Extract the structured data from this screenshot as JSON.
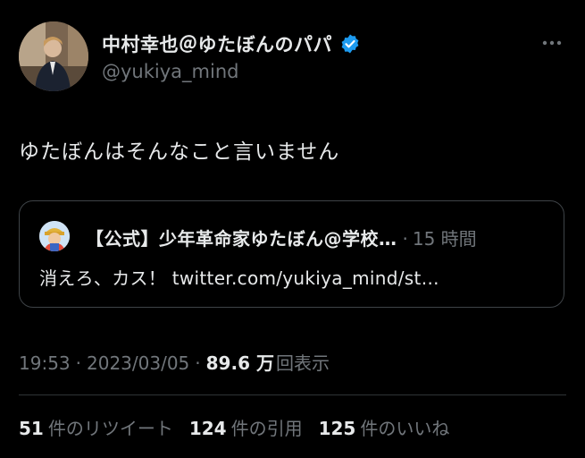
{
  "author": {
    "display_name": "中村幸也＠ゆたぼんのパパ",
    "handle": "@yukiya_mind",
    "verified": true,
    "avatar_icon": "profile-photo",
    "verified_color": "#1d9bf0"
  },
  "tweet": {
    "text": "ゆたぼんはそんなこと言いません"
  },
  "quote": {
    "author_name": "【公式】少年革命家ゆたぼん@学校…",
    "dot": "·",
    "time": "15 時間",
    "text": "消えろ、カス！ twitter.com/yukiya_mind/st…",
    "avatar_icon": "profile-photo"
  },
  "meta": {
    "time": "19:53",
    "sep1": "·",
    "date": "2023/03/05",
    "sep2": "·",
    "views_value": "89.6 万",
    "views_label": "回表示"
  },
  "stats": [
    {
      "value": "51",
      "label": "件のリツイート"
    },
    {
      "value": "124",
      "label": "件の引用"
    },
    {
      "value": "125",
      "label": "件のいいね"
    }
  ],
  "colors": {
    "background": "#000000",
    "text_primary": "#e7e9ea",
    "text_secondary": "#71767b",
    "border": "#2f3336"
  }
}
